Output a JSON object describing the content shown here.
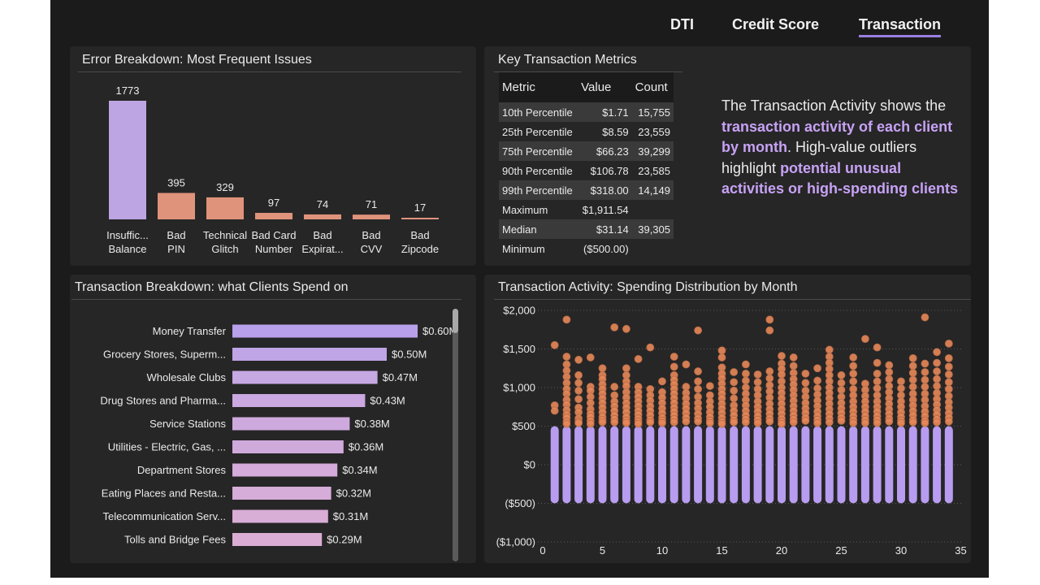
{
  "nav": {
    "tabs": [
      {
        "label": "DTI"
      },
      {
        "label": "Credit Score"
      },
      {
        "label": "Transaction"
      }
    ],
    "active": "Transaction"
  },
  "errors": {
    "title": "Error Breakdown: Most Frequent Issues",
    "chart_data": {
      "type": "bar",
      "categories": [
        "Insuffic... Balance",
        "Bad PIN",
        "Technical Glitch",
        "Bad Card Number",
        "Bad Expirat...",
        "Bad CVV",
        "Bad Zipcode"
      ],
      "values": [
        1773,
        395,
        329,
        97,
        74,
        71,
        17
      ],
      "colors": [
        "#bda5e3",
        "#e0937b",
        "#e0937b",
        "#e0937b",
        "#e0937b",
        "#e0937b",
        "#e0937b"
      ]
    }
  },
  "metrics": {
    "title": "Key Transaction Metrics",
    "columns": [
      "Metric",
      "Value",
      "Count"
    ],
    "rows": [
      {
        "metric": "10th Percentile",
        "value": "$1.71",
        "count": "15,755"
      },
      {
        "metric": "25th Percentile",
        "value": "$8.59",
        "count": "23,559"
      },
      {
        "metric": "75th Percentile",
        "value": "$66.23",
        "count": "39,299"
      },
      {
        "metric": "90th Percentile",
        "value": "$106.78",
        "count": "23,585"
      },
      {
        "metric": "99th Percentile",
        "value": "$318.00",
        "count": "14,149"
      },
      {
        "metric": "Maximum",
        "value": "$1,911.54",
        "count": ""
      },
      {
        "metric": "Median",
        "value": "$31.14",
        "count": "39,305"
      },
      {
        "metric": "Minimum",
        "value": "($500.00)",
        "count": ""
      }
    ]
  },
  "description": {
    "p1": "The Transaction Activity shows the ",
    "h1": "transaction activity of each client by month",
    "p2": ". High-value outliers highlight ",
    "h2": "potential unusual activities or high-spending clients"
  },
  "spend": {
    "title": "Transaction Breakdown: what Clients Spend on",
    "chart_data": {
      "type": "bar",
      "orientation": "horizontal",
      "categories": [
        "Money Transfer",
        "Grocery Stores, Superm...",
        "Wholesale Clubs",
        "Drug Stores and Pharma...",
        "Service Stations",
        "Utilities - Electric, Gas, ...",
        "Department Stores",
        "Eating Places and Resta...",
        "Telecommunication Serv...",
        "Tolls and Bridge Fees"
      ],
      "values": [
        0.6,
        0.5,
        0.47,
        0.43,
        0.38,
        0.36,
        0.34,
        0.32,
        0.31,
        0.29
      ],
      "labels": [
        "$0.60M",
        "$0.50M",
        "$0.47M",
        "$0.43M",
        "$0.38M",
        "$0.36M",
        "$0.34M",
        "$0.32M",
        "$0.31M",
        "$0.29M"
      ],
      "colors": [
        "#b9a0ea",
        "#bfa4e6",
        "#c6a8e3",
        "#cba8e0",
        "#cea9de",
        "#d1aadc",
        "#d4abda",
        "#d6acd8",
        "#d8add6",
        "#daaed4"
      ]
    }
  },
  "activity": {
    "title": "Transaction Activity: Spending Distribution by Month",
    "chart_data": {
      "type": "scatter",
      "x_ticks": [
        0,
        5,
        10,
        15,
        20,
        25,
        30,
        35
      ],
      "y_ticks": [
        2000,
        1500,
        1000,
        500,
        0,
        -500,
        -1000
      ],
      "y_tick_labels": [
        "$2,000",
        "$1,500",
        "$1,000",
        "$500",
        "$0",
        "($500)",
        "($1,000)"
      ],
      "xlim": [
        0,
        35
      ],
      "ylim": [
        -1000,
        2000
      ],
      "threshold": 500,
      "colors": {
        "low": "#b79cf0",
        "high": "#e8885a"
      },
      "months": [
        1,
        2,
        3,
        4,
        5,
        6,
        7,
        8,
        9,
        10,
        11,
        12,
        13,
        14,
        15,
        16,
        17,
        18,
        19,
        20,
        21,
        22,
        23,
        24,
        25,
        26,
        27,
        28,
        29,
        30,
        31,
        32,
        33,
        34
      ],
      "max_values": [
        1550,
        1880,
        1360,
        1390,
        1250,
        1780,
        1760,
        1370,
        1520,
        1080,
        1400,
        1300,
        1740,
        1020,
        1480,
        1200,
        1300,
        1170,
        1880,
        1410,
        1390,
        1180,
        1250,
        1490,
        1160,
        1390,
        1630,
        1520,
        1290,
        1080,
        1380,
        1910,
        1460,
        1570
      ],
      "points": [
        {
          "x": 1,
          "y": [
            1550,
            770,
            700
          ]
        },
        {
          "x": 2,
          "y": [
            1880,
            1400,
            1300,
            1220,
            1140,
            1060,
            980,
            920,
            840,
            780,
            710,
            650,
            610,
            560,
            530
          ]
        },
        {
          "x": 3,
          "y": [
            1360,
            1160,
            1060,
            960,
            850,
            740,
            680,
            600,
            560,
            540
          ]
        },
        {
          "x": 4,
          "y": [
            1390,
            1010,
            960,
            880,
            800,
            720,
            660,
            620,
            570,
            530
          ]
        },
        {
          "x": 5,
          "y": [
            1250,
            1160,
            1110,
            1040,
            980,
            920,
            860,
            800,
            740,
            680,
            620,
            580,
            550
          ]
        },
        {
          "x": 6,
          "y": [
            1780,
            1010,
            900,
            820,
            760,
            700,
            640,
            590,
            550
          ]
        },
        {
          "x": 7,
          "y": [
            1760,
            1250,
            1160,
            1080,
            1020,
            940,
            870,
            800,
            740,
            680,
            620,
            570,
            540
          ]
        },
        {
          "x": 8,
          "y": [
            1370,
            1010,
            940,
            880,
            820,
            760,
            700,
            650,
            600,
            560,
            530
          ]
        },
        {
          "x": 9,
          "y": [
            1520,
            980,
            900,
            830,
            760,
            700,
            640,
            580,
            550
          ]
        },
        {
          "x": 10,
          "y": [
            1080,
            940,
            870,
            800,
            730,
            670,
            610,
            570,
            540
          ]
        },
        {
          "x": 11,
          "y": [
            1400,
            1270,
            1160,
            1100,
            1040,
            980,
            920,
            860,
            800,
            740,
            690,
            640,
            590,
            550
          ]
        },
        {
          "x": 12,
          "y": [
            1300,
            1010,
            930,
            860,
            790,
            730,
            670,
            610,
            560
          ]
        },
        {
          "x": 13,
          "y": [
            1740,
            1210,
            1080,
            980,
            880,
            800,
            730,
            660,
            600,
            560
          ]
        },
        {
          "x": 14,
          "y": [
            1020,
            900,
            820,
            750,
            680,
            620,
            570,
            540
          ]
        },
        {
          "x": 15,
          "y": [
            1480,
            1390,
            1260,
            1180,
            1120,
            1050,
            980,
            920,
            860,
            790,
            730,
            670,
            610,
            560,
            530
          ]
        },
        {
          "x": 16,
          "y": [
            1200,
            1070,
            960,
            860,
            770,
            700,
            640,
            580,
            550
          ]
        },
        {
          "x": 17,
          "y": [
            1300,
            1180,
            1090,
            1000,
            920,
            840,
            770,
            700,
            640,
            590,
            550
          ]
        },
        {
          "x": 18,
          "y": [
            1170,
            1070,
            980,
            900,
            820,
            750,
            690,
            630,
            580,
            540
          ]
        },
        {
          "x": 19,
          "y": [
            1880,
            1740,
            1210,
            1120,
            1030,
            950,
            870,
            790,
            720,
            660,
            600,
            560
          ]
        },
        {
          "x": 20,
          "y": [
            1410,
            1310,
            1240,
            1170,
            1080,
            1000,
            930,
            860,
            790,
            720,
            660,
            600,
            560,
            530
          ]
        },
        {
          "x": 21,
          "y": [
            1390,
            1280,
            1190,
            1110,
            1040,
            970,
            900,
            830,
            760,
            700,
            640,
            590,
            550
          ]
        },
        {
          "x": 22,
          "y": [
            1180,
            1060,
            960,
            880,
            800,
            730,
            670,
            610,
            570
          ]
        },
        {
          "x": 23,
          "y": [
            1250,
            1090,
            990,
            910,
            830,
            760,
            690,
            630,
            580,
            540
          ]
        },
        {
          "x": 24,
          "y": [
            1490,
            1400,
            1320,
            1240,
            1160,
            1080,
            1000,
            930,
            860,
            790,
            720,
            660,
            600,
            550
          ]
        },
        {
          "x": 25,
          "y": [
            1160,
            1060,
            970,
            880,
            800,
            730,
            670,
            610,
            570
          ]
        },
        {
          "x": 26,
          "y": [
            1390,
            1280,
            1180,
            1080,
            980,
            900,
            820,
            750,
            690,
            630,
            580,
            540
          ]
        },
        {
          "x": 27,
          "y": [
            1630,
            1050,
            970,
            890,
            820,
            750,
            690,
            630,
            580,
            540
          ]
        },
        {
          "x": 28,
          "y": [
            1520,
            1320,
            1180,
            1080,
            990,
            900,
            820,
            750,
            690,
            630,
            580,
            540
          ]
        },
        {
          "x": 29,
          "y": [
            1290,
            1200,
            1110,
            1020,
            940,
            860,
            790,
            720,
            660,
            600,
            560
          ]
        },
        {
          "x": 30,
          "y": [
            1080,
            990,
            900,
            820,
            750,
            680,
            620,
            570,
            540
          ]
        },
        {
          "x": 31,
          "y": [
            1380,
            1280,
            1190,
            1100,
            1010,
            920,
            840,
            770,
            700,
            640,
            580,
            550
          ]
        },
        {
          "x": 32,
          "y": [
            1910,
            1310,
            1200,
            1100,
            1010,
            920,
            840,
            760,
            690,
            630,
            570,
            540
          ]
        },
        {
          "x": 33,
          "y": [
            1460,
            1320,
            1210,
            1110,
            1020,
            930,
            850,
            780,
            710,
            650,
            590,
            550
          ]
        },
        {
          "x": 34,
          "y": [
            1570,
            1380,
            1270,
            1170,
            1070,
            980,
            890,
            810,
            740,
            670,
            610,
            560
          ]
        }
      ]
    }
  }
}
